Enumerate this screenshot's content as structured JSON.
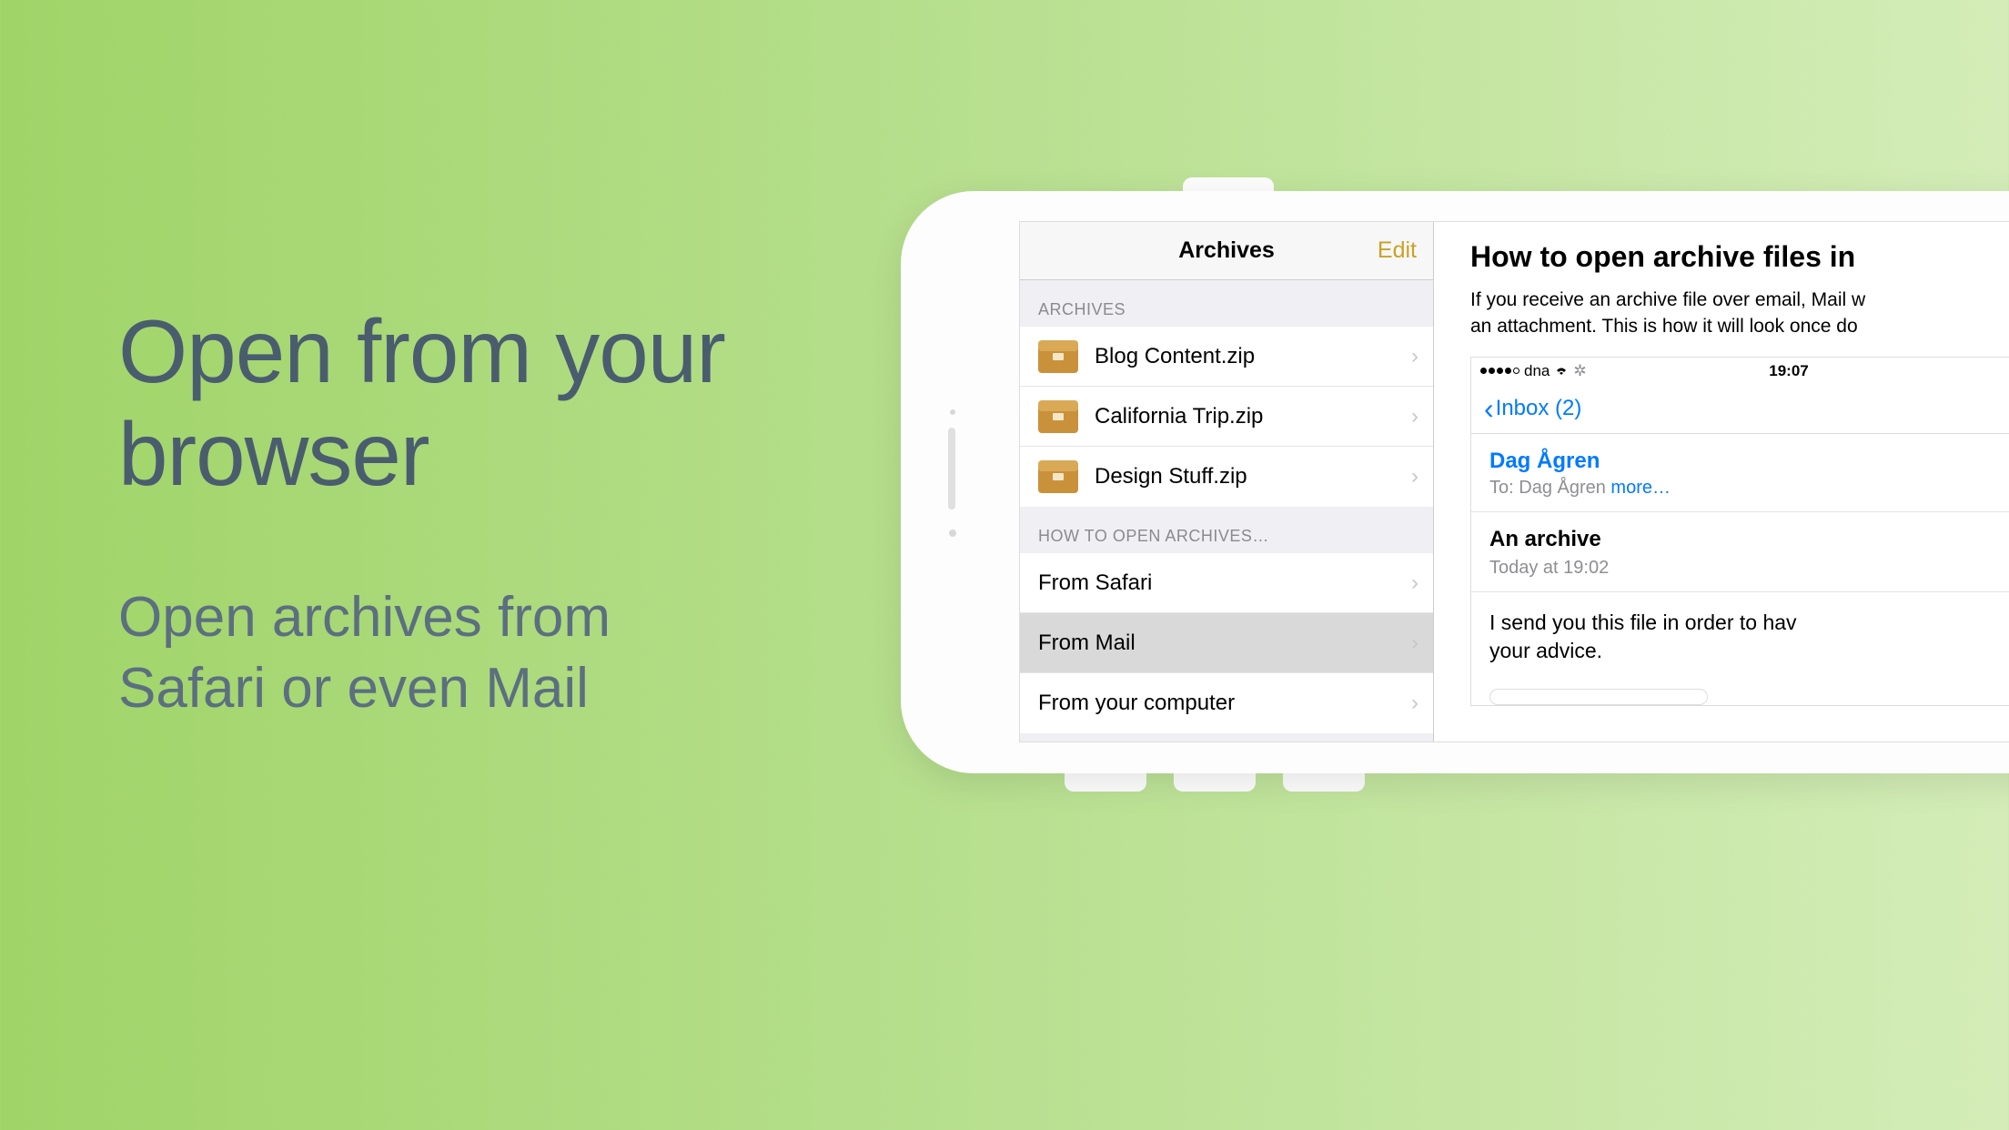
{
  "marketing": {
    "headline_line1": "Open from your",
    "headline_line2": "browser",
    "sub_line1": "Open archives from",
    "sub_line2": "Safari or even Mail"
  },
  "sidebar": {
    "title": "Archives",
    "edit": "Edit",
    "section_archives": "ARCHIVES",
    "archives": [
      {
        "label": "Blog Content.zip"
      },
      {
        "label": "California Trip.zip"
      },
      {
        "label": "Design Stuff.zip"
      }
    ],
    "section_howto": "HOW TO OPEN ARCHIVES…",
    "howto": [
      {
        "label": "From Safari",
        "selected": false
      },
      {
        "label": "From Mail",
        "selected": true
      },
      {
        "label": "From your computer",
        "selected": false
      }
    ]
  },
  "detail": {
    "title": "How to open archive files in",
    "desc_line1": "If you receive an archive file over email, Mail w",
    "desc_line2": "an attachment. This is how it will look once do"
  },
  "mail": {
    "statusbar": {
      "carrier": "dna",
      "time": "19:07"
    },
    "back_label": "Inbox (2)",
    "from": "Dag Ågren",
    "to_prefix": "To: ",
    "to_name": "Dag Ågren",
    "more": " more…",
    "subject": "An archive",
    "date": "Today at 19:02",
    "body_line1": "I send you this file in order to hav",
    "body_line2": "your advice."
  }
}
